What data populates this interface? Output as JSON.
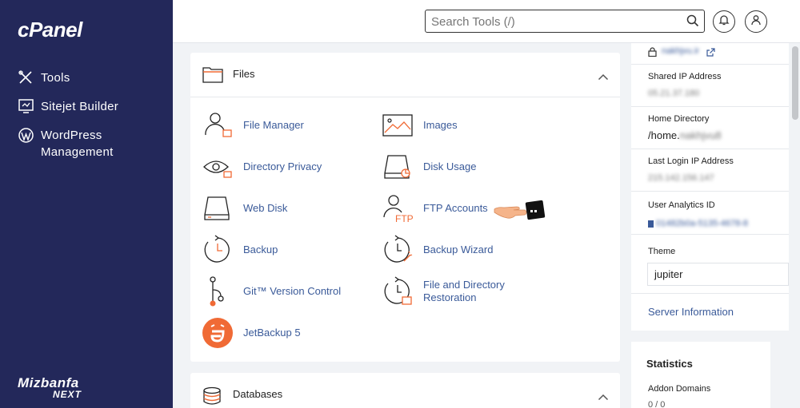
{
  "sidebar": {
    "logo": "cPanel",
    "items": [
      {
        "label": "Tools",
        "icon": "tools-icon"
      },
      {
        "label": "Sitejet Builder",
        "icon": "sitejet-icon"
      },
      {
        "label": "WordPress",
        "label2": "Management",
        "icon": "wordpress-icon"
      }
    ],
    "brand_line1": "Mizbanfa",
    "brand_line2": "NEXT"
  },
  "header": {
    "search_placeholder": "Search Tools (/)"
  },
  "files": {
    "title": "Files",
    "tools": [
      {
        "label": "File Manager"
      },
      {
        "label": "Images"
      },
      {
        "label": "Directory Privacy"
      },
      {
        "label": "Disk Usage"
      },
      {
        "label": "Web Disk"
      },
      {
        "label": "FTP Accounts"
      },
      {
        "label": "Backup"
      },
      {
        "label": "Backup Wizard"
      },
      {
        "label": "Git™ Version Control"
      },
      {
        "label": "File and Directory",
        "label2": "Restoration"
      },
      {
        "label": "JetBackup 5"
      }
    ],
    "ftp_icon_text": "FTP"
  },
  "databases": {
    "title": "Databases"
  },
  "info": {
    "domain_value": "nakhjvu.ir",
    "shared_ip_label": "Shared IP Address",
    "shared_ip_value": "05.21.37.180",
    "home_dir_label": "Home Directory",
    "home_dir_value": "/home.",
    "home_dir_blur": "nakhjvu8",
    "last_login_label": "Last Login IP Address",
    "last_login_value": "215.142.156.147",
    "analytics_label": "User Analytics ID",
    "analytics_value": "01482b0a-5135-4678-8",
    "theme_label": "Theme",
    "theme_value": "jupiter",
    "server_info": "Server Information"
  },
  "stats": {
    "title": "Statistics",
    "addon_label": "Addon Domains",
    "addon_value": "0 / 0"
  },
  "colors": {
    "sidebar_bg": "#23285a",
    "link": "#3a5a99",
    "accent": "#f06a35"
  }
}
